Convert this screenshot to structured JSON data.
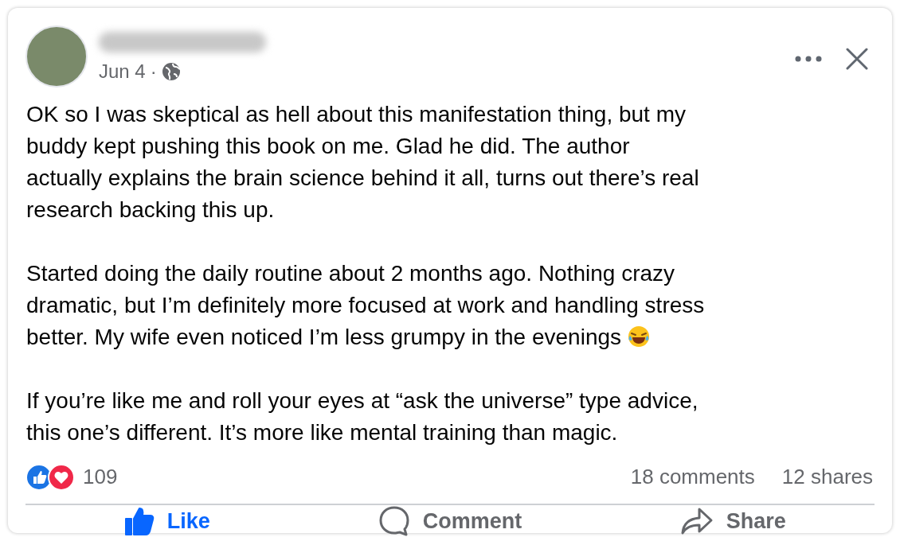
{
  "post": {
    "date": "Jun 4",
    "separator": "·",
    "paragraphs": [
      {
        "text": "OK so I was skeptical as hell about this manifestation thing, but my buddy kept pushing this book on me. Glad he did. The author actually explains the brain science behind it all, turns out there’s real research backing this up.",
        "kind": "plain"
      },
      {
        "text": "Started doing the daily routine about 2 months ago. Nothing crazy dramatic, but I’m definitely more focused at work and handling stress better. My wife even noticed I’m less grumpy in the evenings",
        "kind": "ends_with_laughing_emoji"
      },
      {
        "text": "If you’re like me and roll your eyes at “ask the universe” type advice, this one’s different. It’s more like mental training than magic.",
        "kind": "plain"
      }
    ],
    "reactions_count": "109",
    "comments": "18 comments",
    "shares": "12 shares",
    "actions": [
      {
        "kind": "like",
        "label": "Like",
        "selected": true
      },
      {
        "kind": "comment",
        "label": "Comment",
        "selected": false
      },
      {
        "kind": "share",
        "label": "Share",
        "selected": false
      }
    ]
  }
}
